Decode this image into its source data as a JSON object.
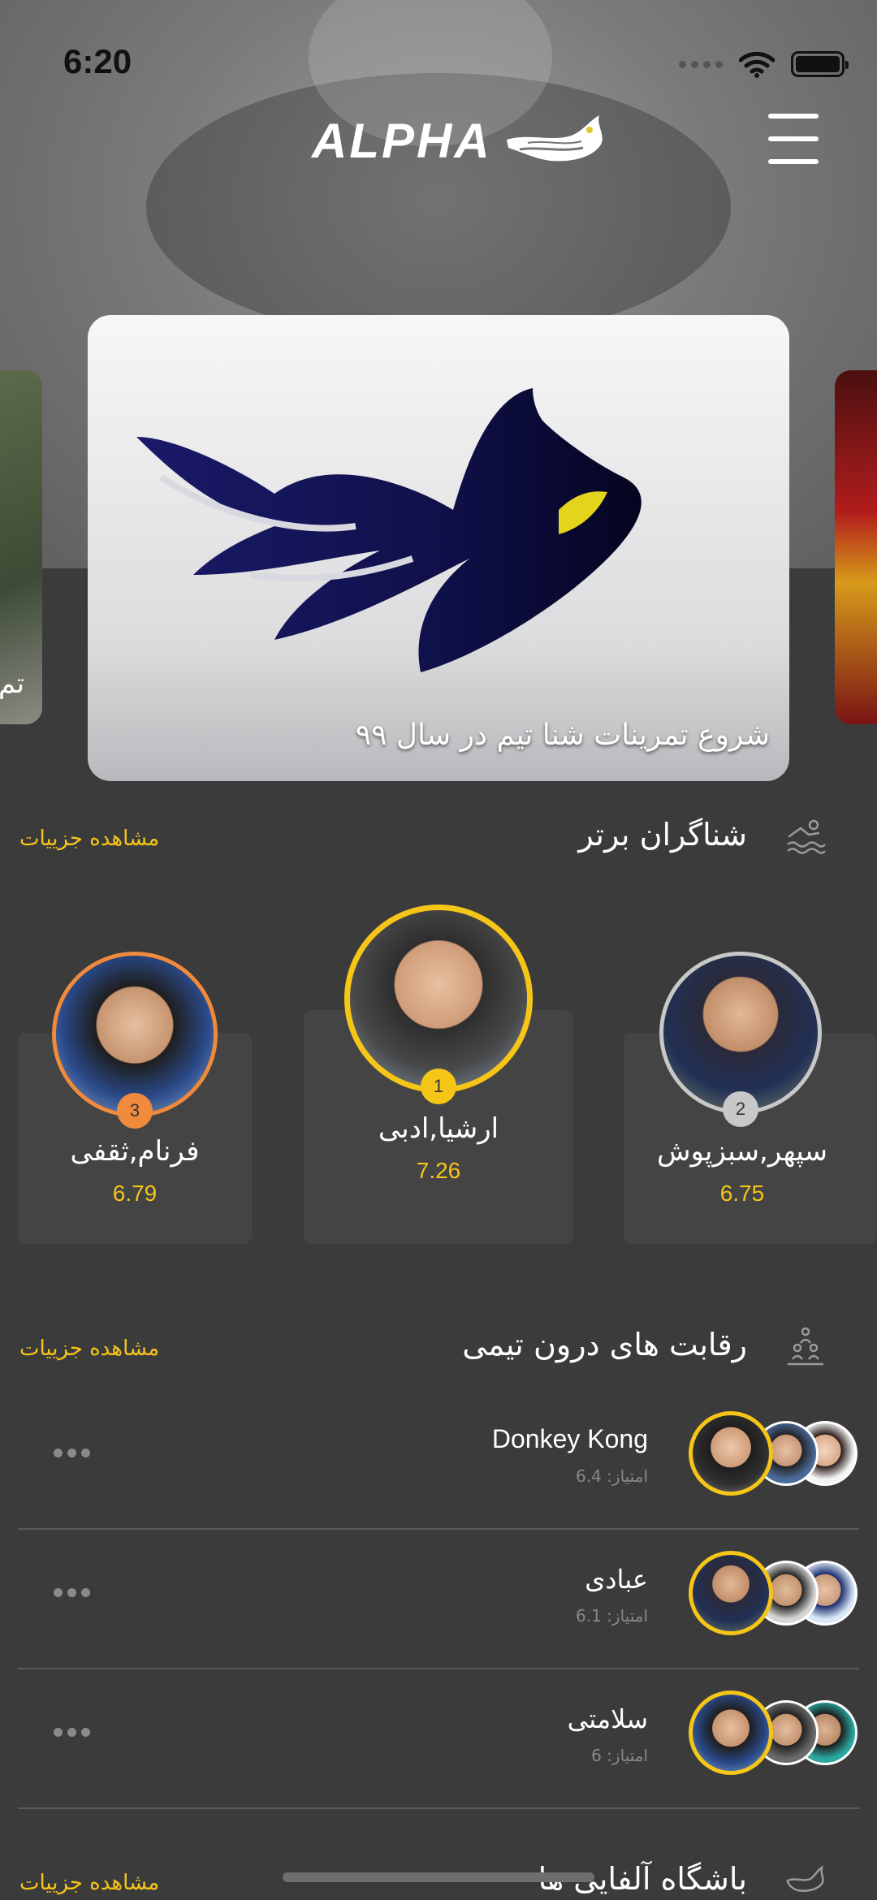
{
  "status_bar": {
    "time": "6:20"
  },
  "header": {
    "logo_text": "ALPHA"
  },
  "carousel": {
    "main_caption": "شروع تمرینات شنا تیم در سال ۹۹",
    "left_card_text": "تم"
  },
  "top_swimmers": {
    "title": "شناگران برتر",
    "link": "مشاهده جزییات",
    "ranks": [
      {
        "rank": "1",
        "name": "ارشیا,ادبی",
        "score": "7.26"
      },
      {
        "rank": "2",
        "name": "سپهر,سبزپوش",
        "score": "6.75"
      },
      {
        "rank": "3",
        "name": "فرنام,ثقفی",
        "score": "6.79"
      }
    ]
  },
  "competitions": {
    "title": "رقابت های درون تیمی",
    "link": "مشاهده جزییات",
    "items": [
      {
        "name": "Donkey Kong",
        "score": "امتیاز: 6.4"
      },
      {
        "name": "عبادی",
        "score": "امتیاز: 6.1"
      },
      {
        "name": "سلامتی",
        "score": "امتیاز: 6"
      }
    ]
  },
  "club": {
    "title": "باشگاه آلفایی ها",
    "link": "مشاهده جزییات"
  },
  "colors": {
    "accent": "#f5c518",
    "silver": "#c8c8c8",
    "bronze": "#f08a3c",
    "background": "#3b3b3b"
  }
}
